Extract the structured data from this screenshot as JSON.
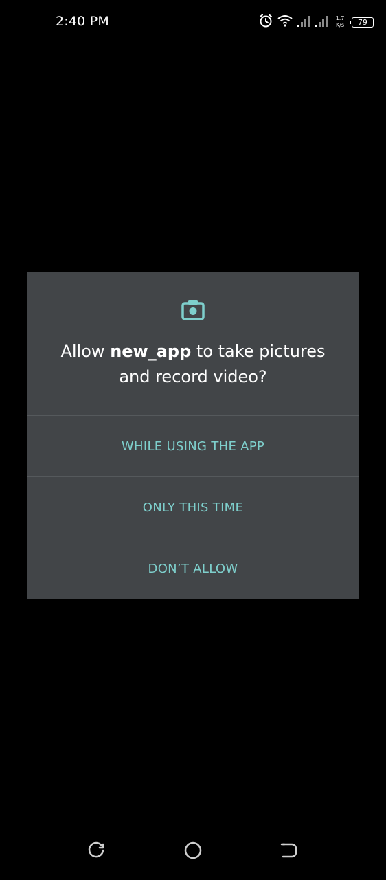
{
  "status_bar": {
    "time": "2:40 PM",
    "net_speed_value": "1.7",
    "net_speed_unit": "K/s",
    "battery_level": "79",
    "icons": [
      "alarm-icon",
      "wifi-icon",
      "signal-icon",
      "signal-icon",
      "battery-icon"
    ]
  },
  "dialog": {
    "icon": "camera-icon",
    "message_prefix": "Allow",
    "app_name": "new_app",
    "message_suffix": "to take pictures and record video?",
    "options": [
      {
        "label": "WHILE USING THE APP"
      },
      {
        "label": "ONLY THIS TIME"
      },
      {
        "label": "DON’T ALLOW"
      }
    ]
  },
  "nav_bar": {
    "icons": [
      "recent-apps-icon",
      "home-icon",
      "back-icon"
    ]
  },
  "colors": {
    "background": "#000000",
    "dialog_background": "#424548",
    "accent": "#7ecfcc",
    "divider": "#55595c"
  }
}
